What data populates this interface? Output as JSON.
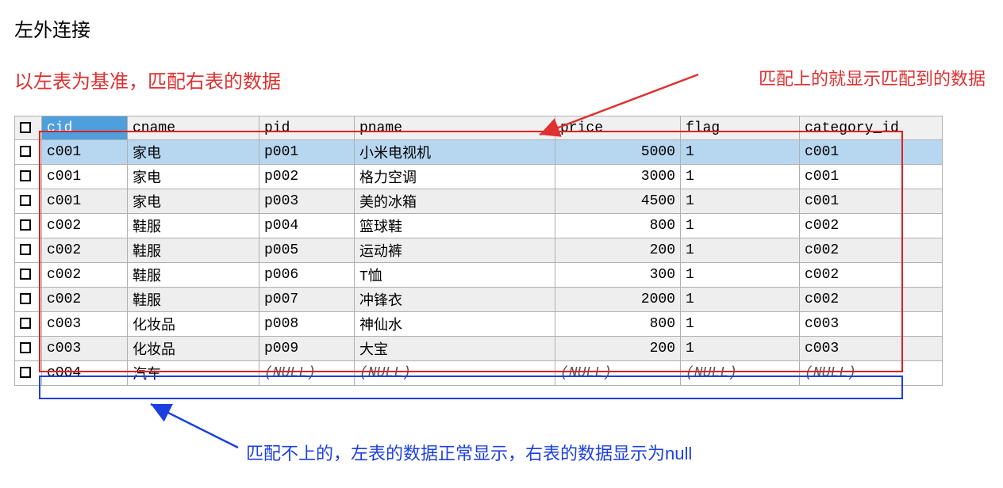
{
  "title": "左外连接",
  "subtitle_red": "以左表为基准，匹配右表的数据",
  "annotation_red": "匹配上的就显示匹配到的数据",
  "annotation_blue": "匹配不上的，左表的数据正常显示，右表的数据显示为null",
  "columns": {
    "cid": "cid",
    "cname": "cname",
    "pid": "pid",
    "pname": "pname",
    "price": "price",
    "flag": "flag",
    "category_id": "category_id"
  },
  "null_label": "(NULL)",
  "rows": [
    {
      "cid": "c001",
      "cname": "家电",
      "pid": "p001",
      "pname": "小米电视机",
      "price": "5000",
      "flag": "1",
      "category_id": "c001"
    },
    {
      "cid": "c001",
      "cname": "家电",
      "pid": "p002",
      "pname": "格力空调",
      "price": "3000",
      "flag": "1",
      "category_id": "c001"
    },
    {
      "cid": "c001",
      "cname": "家电",
      "pid": "p003",
      "pname": "美的冰箱",
      "price": "4500",
      "flag": "1",
      "category_id": "c001"
    },
    {
      "cid": "c002",
      "cname": "鞋服",
      "pid": "p004",
      "pname": "篮球鞋",
      "price": "800",
      "flag": "1",
      "category_id": "c002"
    },
    {
      "cid": "c002",
      "cname": "鞋服",
      "pid": "p005",
      "pname": "运动裤",
      "price": "200",
      "flag": "1",
      "category_id": "c002"
    },
    {
      "cid": "c002",
      "cname": "鞋服",
      "pid": "p006",
      "pname": "T恤",
      "price": "300",
      "flag": "1",
      "category_id": "c002"
    },
    {
      "cid": "c002",
      "cname": "鞋服",
      "pid": "p007",
      "pname": "冲锋衣",
      "price": "2000",
      "flag": "1",
      "category_id": "c002"
    },
    {
      "cid": "c003",
      "cname": "化妆品",
      "pid": "p008",
      "pname": "神仙水",
      "price": "800",
      "flag": "1",
      "category_id": "c003"
    },
    {
      "cid": "c003",
      "cname": "化妆品",
      "pid": "p009",
      "pname": "大宝",
      "price": "200",
      "flag": "1",
      "category_id": "c003"
    },
    {
      "cid": "c004",
      "cname": "汽车",
      "pid": null,
      "pname": null,
      "price": null,
      "flag": null,
      "category_id": null
    }
  ]
}
